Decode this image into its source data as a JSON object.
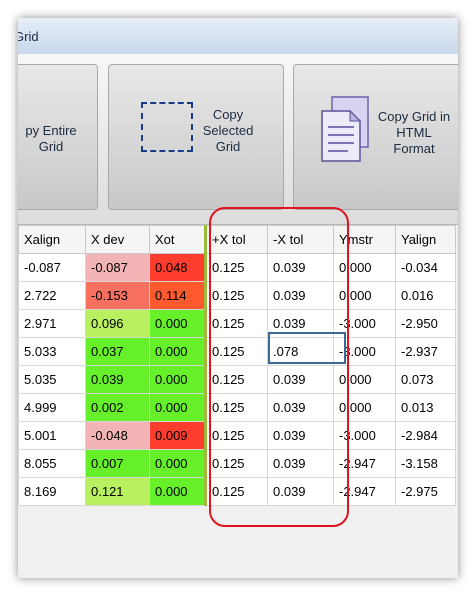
{
  "window": {
    "title_fragment": "Grid"
  },
  "toolbar": {
    "copy_entire": {
      "label": "Copy Entire Grid",
      "visible_text": "py Entire\nGrid"
    },
    "copy_selected": {
      "label": "Copy Selected Grid",
      "visible_text": "Copy\nSelected\nGrid"
    },
    "copy_html": {
      "label": "Copy Grid in HTML Format",
      "visible_text": "Copy Grid in\nHTML\nFormat"
    }
  },
  "grid": {
    "columns": [
      "Xalign",
      "X dev",
      "Xot",
      "+X tol",
      "-X tol",
      "Ymstr",
      "Yalign"
    ],
    "rows": [
      [
        "-0.087",
        "-0.087",
        "0.048",
        "0.125",
        "0.039",
        "0.000",
        "-0.034"
      ],
      [
        "2.722",
        "-0.153",
        "0.114",
        "0.125",
        "0.039",
        "0.000",
        "0.016"
      ],
      [
        "2.971",
        "0.096",
        "0.000",
        "0.125",
        "0.039",
        "-3.000",
        "-2.950"
      ],
      [
        "5.033",
        "0.037",
        "0.000",
        "0.125",
        ".078",
        "-3.000",
        "-2.937"
      ],
      [
        "5.035",
        "0.039",
        "0.000",
        "0.125",
        "0.039",
        "0.000",
        "0.073"
      ],
      [
        "4.999",
        "0.002",
        "0.000",
        "0.125",
        "0.039",
        "0.000",
        "0.013"
      ],
      [
        "5.001",
        "-0.048",
        "0.009",
        "0.125",
        "0.039",
        "-3.000",
        "-2.984"
      ],
      [
        "8.055",
        "0.007",
        "0.000",
        "0.125",
        "0.039",
        "-2.947",
        "-3.158"
      ],
      [
        "8.169",
        "0.121",
        "0.000",
        "0.125",
        "0.039",
        "-2.947",
        "-2.975"
      ]
    ],
    "xdev_colors": [
      "#f2b4b4",
      "#f77060",
      "#b8f060",
      "#66f02a",
      "#66f02a",
      "#66f02a",
      "#f2b4b4",
      "#66f02a",
      "#b8f060"
    ],
    "xot_colors": [
      "#ff3d2e",
      "#ff5a2e",
      "#66f02a",
      "#66f02a",
      "#66f02a",
      "#66f02a",
      "#ff3d2e",
      "#66f02a",
      "#66f02a"
    ],
    "editing_cell": {
      "row": 3,
      "column": "-X tol",
      "value": ".078"
    }
  },
  "colors": {
    "highlight_red": "#e0141e",
    "edit_border": "#3d6891",
    "separator_green": "#9bbc3a"
  }
}
